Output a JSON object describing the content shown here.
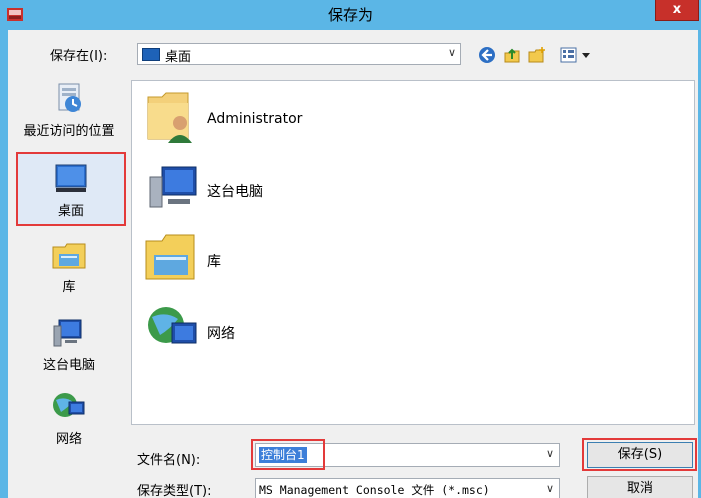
{
  "window": {
    "title": "保存为",
    "close_label": "x"
  },
  "toolbar": {
    "save_in_label": "保存在(I):",
    "location": "桌面",
    "location_arrow": "∨"
  },
  "places": [
    {
      "label": "最近访问的位置"
    },
    {
      "label": "桌面"
    },
    {
      "label": "库"
    },
    {
      "label": "这台电脑"
    },
    {
      "label": "网络"
    }
  ],
  "files": [
    {
      "label": "Administrator"
    },
    {
      "label": "这台电脑"
    },
    {
      "label": "库"
    },
    {
      "label": "网络"
    }
  ],
  "form": {
    "filename_label": "文件名(N):",
    "filename_value": "控制台1",
    "filetype_label": "保存类型(T):",
    "filetype_value": "MS Management Console 文件 (*.msc)",
    "arrow": "∨"
  },
  "buttons": {
    "save": "保存(S)",
    "cancel": "取消"
  },
  "colors": {
    "titlebar": "#5bb6e6",
    "close": "#c7302a",
    "highlight": "#e33a3a",
    "selection": "#3d7fd9"
  }
}
